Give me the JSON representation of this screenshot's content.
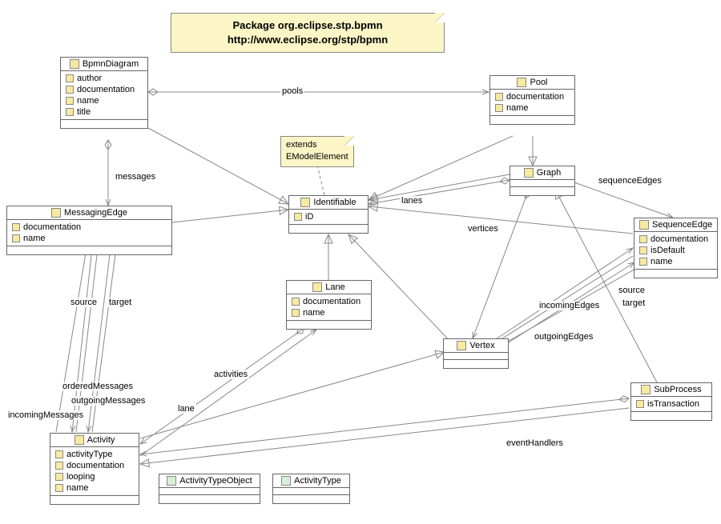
{
  "package_note": {
    "line1": "Package org.eclipse.stp.bpmn",
    "line2": "http://www.eclipse.org/stp/bpmn"
  },
  "extends_note": "extends\nEModelElement",
  "classes": {
    "BpmnDiagram": {
      "name": "BpmnDiagram",
      "attrs": [
        "author",
        "documentation",
        "name",
        "title"
      ]
    },
    "Pool": {
      "name": "Pool",
      "attrs": [
        "documentation",
        "name"
      ]
    },
    "MessagingEdge": {
      "name": "MessagingEdge",
      "attrs": [
        "documentation",
        "name"
      ]
    },
    "Identifiable": {
      "name": "Identifiable",
      "attrs": [
        "iD"
      ]
    },
    "Graph": {
      "name": "Graph",
      "attrs": []
    },
    "SequenceEdge": {
      "name": "SequenceEdge",
      "attrs": [
        "documentation",
        "isDefault",
        "name"
      ]
    },
    "Lane": {
      "name": "Lane",
      "attrs": [
        "documentation",
        "name"
      ]
    },
    "Vertex": {
      "name": "Vertex",
      "attrs": []
    },
    "SubProcess": {
      "name": "SubProcess",
      "attrs": [
        "isTransaction"
      ]
    },
    "Activity": {
      "name": "Activity",
      "attrs": [
        "activityType",
        "documentation",
        "looping",
        "name"
      ]
    },
    "ActivityTypeObject": {
      "name": "ActivityTypeObject",
      "attrs": []
    },
    "ActivityType": {
      "name": "ActivityType",
      "attrs": []
    }
  },
  "edge_labels": {
    "pools": "pools",
    "messages": "messages",
    "lanes": "lanes",
    "sequenceEdges": "sequenceEdges",
    "vertices": "vertices",
    "source_msg": "source",
    "target_msg": "target",
    "activities": "activities",
    "lane": "lane",
    "incomingEdges": "incomingEdges",
    "outgoingEdges": "outgoingEdges",
    "source_seq": "source",
    "target_seq": "target",
    "orderedMessages": "orderedMessages",
    "outgoingMessages": "outgoingMessages",
    "incomingMessages": "incomingMessages",
    "eventHandlers": "eventHandlers"
  }
}
